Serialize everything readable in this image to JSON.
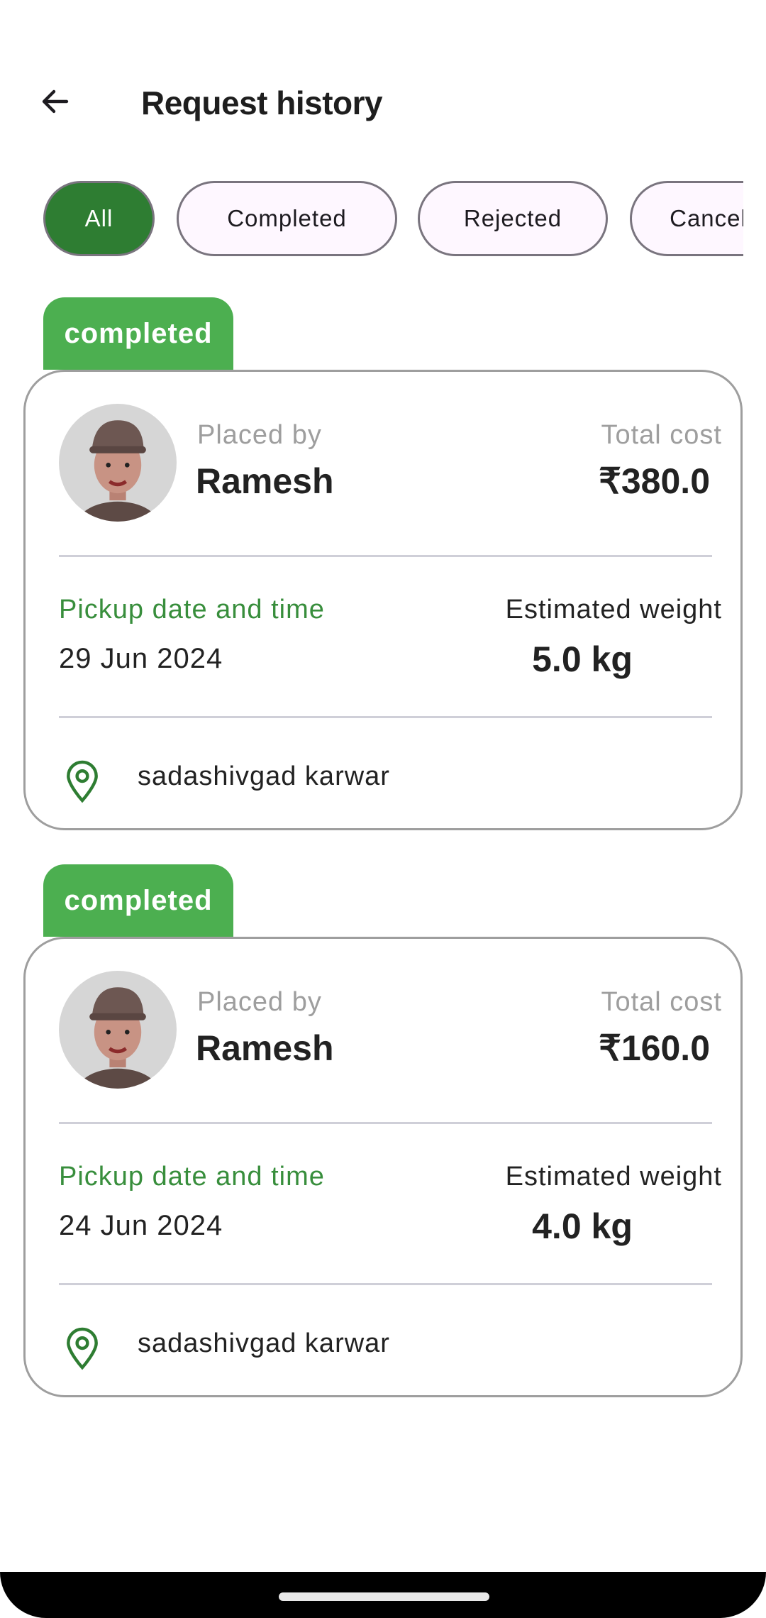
{
  "header": {
    "title": "Request history",
    "back_icon": "arrow-left-icon"
  },
  "filters": [
    {
      "label": "All",
      "active": true
    },
    {
      "label": "Completed",
      "active": false
    },
    {
      "label": "Rejected",
      "active": false
    },
    {
      "label": "Cancelled",
      "active": false
    }
  ],
  "requests": [
    {
      "status": "completed",
      "placed_by_label": "Placed by",
      "name": "Ramesh",
      "total_cost_label": "Total cost",
      "total_cost": "₹380.0",
      "pickup_label": "Pickup date and time",
      "pickup_date": "29 Jun 2024",
      "weight_label": "Estimated weight",
      "weight": "5.0 kg",
      "location": "sadashivgad karwar"
    },
    {
      "status": "completed",
      "placed_by_label": "Placed by",
      "name": "Ramesh",
      "total_cost_label": "Total cost",
      "total_cost": "₹160.0",
      "pickup_label": "Pickup date and time",
      "pickup_date": "24 Jun 2024",
      "weight_label": "Estimated weight",
      "weight": "4.0 kg",
      "location": "sadashivgad karwar"
    }
  ],
  "colors": {
    "primary": "#2e7d32",
    "badge": "#4caf50",
    "label_green": "#388e3c"
  }
}
